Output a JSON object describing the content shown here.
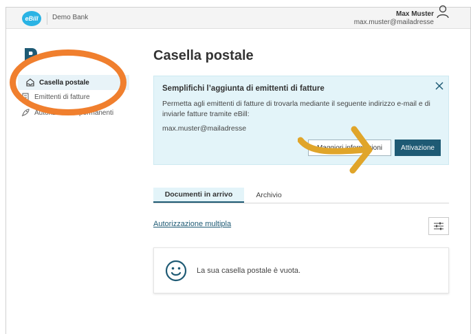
{
  "header": {
    "logo_text": "eBill",
    "bank_name": "Demo Bank",
    "user_name": "Max Muster",
    "user_email": "max.muster@mailadresse"
  },
  "sidebar": {
    "items": [
      {
        "label": "Casella postale",
        "icon": "mailbox-icon",
        "active": true
      },
      {
        "label": "Emittenti di fatture",
        "icon": "document-icon",
        "active": false
      },
      {
        "label": "Autorizzazioni permanenti",
        "icon": "rocket-icon",
        "active": false
      }
    ]
  },
  "main": {
    "title": "Casella postale",
    "info_box": {
      "title": "Semplifichi l’aggiunta di emittenti di fatture",
      "text": "Permetta agli emittenti di fatture di trovarla mediante il seguente indirizzo e-mail e di inviarle fatture tramite eBill:",
      "email": "max.muster@mailadresse",
      "secondary_button": "Maggiori informazioni",
      "primary_button": "Attivazione"
    },
    "tabs": [
      {
        "label": "Documenti in arrivo",
        "active": true
      },
      {
        "label": "Archivio",
        "active": false
      }
    ],
    "multi_auth_link": "Autorizzazione multipla",
    "empty_message": "La sua casella postale è vuota."
  },
  "colors": {
    "accent": "#1e5a74",
    "info_bg": "#e3f4f9",
    "ebill_blue": "#2ab3e4",
    "annotation_orange": "#f07f2e",
    "annotation_arrow": "#e0a52a"
  }
}
